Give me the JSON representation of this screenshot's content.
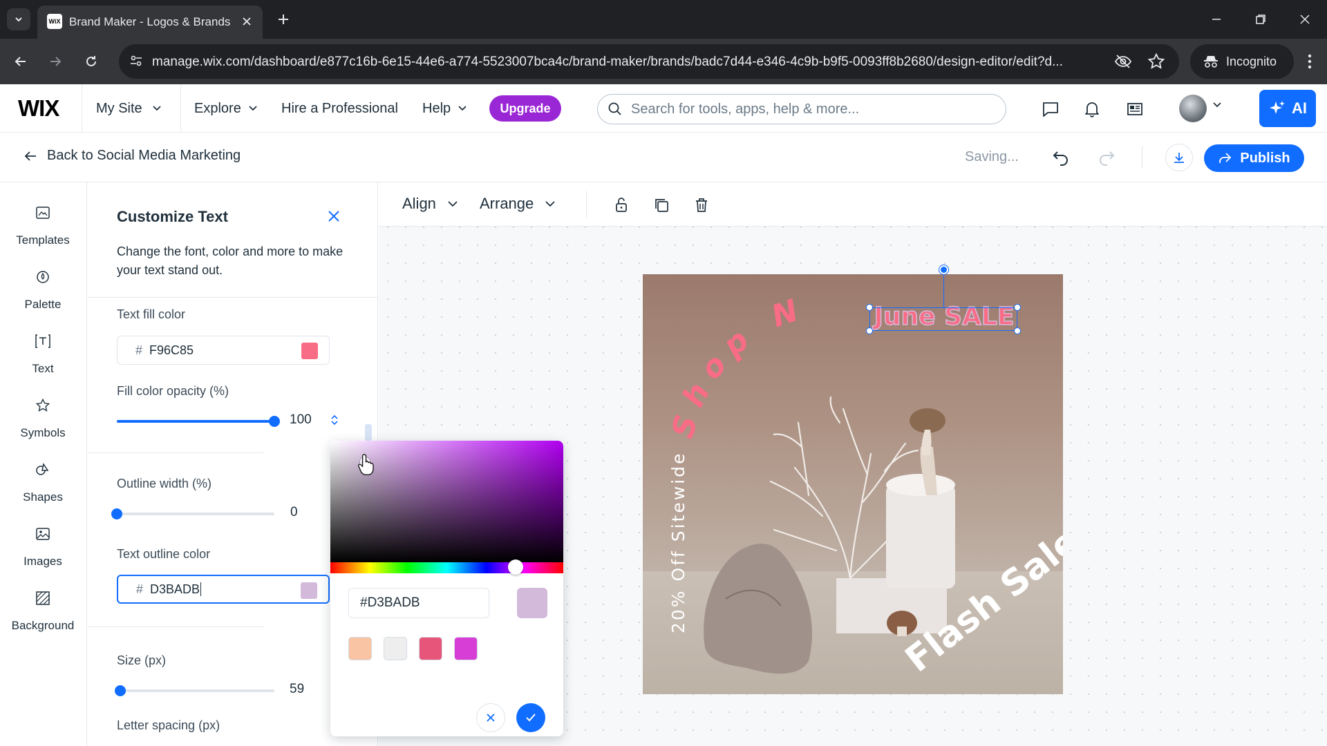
{
  "browser": {
    "tab_title": "Brand Maker - Logos & Brands",
    "favicon_text": "WiX",
    "url": "manage.wix.com/dashboard/e877c16b-6e15-44e6-a774-5523007bca4c/brand-maker/brands/badc7d44-e346-4c9b-b9f5-0093ff8b2680/design-editor/edit?d...",
    "incognito_label": "Incognito"
  },
  "wix_header": {
    "logo": "WIX",
    "my_site": "My Site",
    "nav": [
      "Explore",
      "Hire a Professional",
      "Help"
    ],
    "upgrade": "Upgrade",
    "search_placeholder": "Search for tools, apps, help & more...",
    "ai_label": "AI"
  },
  "editor_header": {
    "back_label": "Back to Social Media Marketing",
    "status": "Saving...",
    "publish": "Publish"
  },
  "rail": {
    "items": [
      {
        "label": "Templates",
        "icon": "templates-icon"
      },
      {
        "label": "Palette",
        "icon": "palette-icon"
      },
      {
        "label": "Text",
        "icon": "text-icon"
      },
      {
        "label": "Symbols",
        "icon": "star-icon"
      },
      {
        "label": "Shapes",
        "icon": "shapes-icon"
      },
      {
        "label": "Images",
        "icon": "image-icon"
      },
      {
        "label": "Background",
        "icon": "background-icon"
      }
    ]
  },
  "panel": {
    "title": "Customize Text",
    "description": "Change the font, color and more to make your text stand out.",
    "fill_color_label": "Text fill color",
    "fill_color_hash": "#",
    "fill_color_value": "F96C85",
    "fill_color": "#F96C85",
    "opacity_label": "Fill color opacity (%)",
    "opacity_value": "100",
    "outline_width_label": "Outline width (%)",
    "outline_width_value": "0",
    "outline_color_label": "Text outline color",
    "outline_color_hash": "#",
    "outline_color_value": "D3BADB",
    "outline_color": "#D3BADB",
    "size_label": "Size (px)",
    "size_value": "59",
    "size_fraction": 0.02,
    "letter_spacing_label": "Letter spacing (px)"
  },
  "color_picker": {
    "hex_value": "#D3BADB",
    "preview_color": "#D3BADB",
    "presets": [
      "#F9C4A4",
      "#EEEEEE",
      "#E8557A",
      "#D63ED6"
    ]
  },
  "toolbar": {
    "align": "Align",
    "arrange": "Arrange"
  },
  "design": {
    "selected_text": "June SALE",
    "arc_text": "Shop Now",
    "side_text": "20% Off Sitewide",
    "flash_text": "Flash Sale",
    "accent_color": "#F96C85"
  }
}
